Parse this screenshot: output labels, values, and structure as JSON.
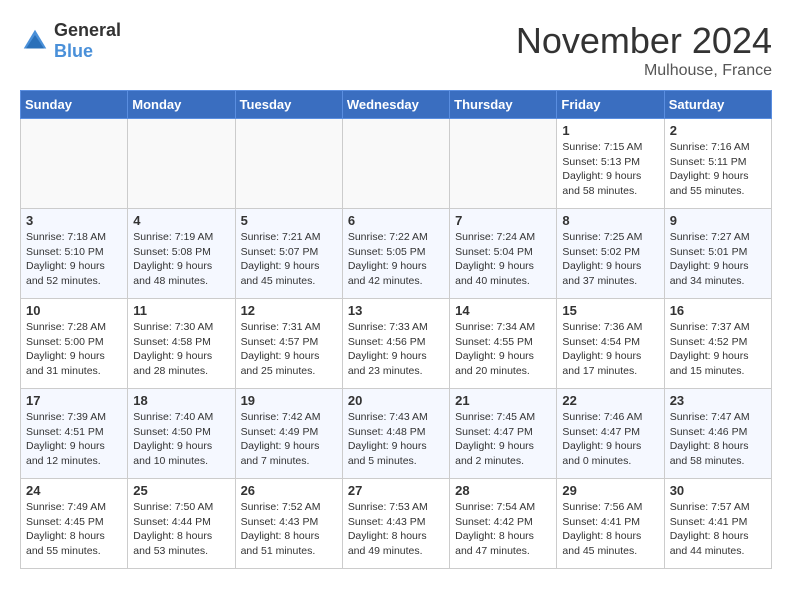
{
  "logo": {
    "text_general": "General",
    "text_blue": "Blue"
  },
  "title": "November 2024",
  "location": "Mulhouse, France",
  "headers": [
    "Sunday",
    "Monday",
    "Tuesday",
    "Wednesday",
    "Thursday",
    "Friday",
    "Saturday"
  ],
  "weeks": [
    [
      {
        "day": "",
        "info": ""
      },
      {
        "day": "",
        "info": ""
      },
      {
        "day": "",
        "info": ""
      },
      {
        "day": "",
        "info": ""
      },
      {
        "day": "",
        "info": ""
      },
      {
        "day": "1",
        "info": "Sunrise: 7:15 AM\nSunset: 5:13 PM\nDaylight: 9 hours\nand 58 minutes."
      },
      {
        "day": "2",
        "info": "Sunrise: 7:16 AM\nSunset: 5:11 PM\nDaylight: 9 hours\nand 55 minutes."
      }
    ],
    [
      {
        "day": "3",
        "info": "Sunrise: 7:18 AM\nSunset: 5:10 PM\nDaylight: 9 hours\nand 52 minutes."
      },
      {
        "day": "4",
        "info": "Sunrise: 7:19 AM\nSunset: 5:08 PM\nDaylight: 9 hours\nand 48 minutes."
      },
      {
        "day": "5",
        "info": "Sunrise: 7:21 AM\nSunset: 5:07 PM\nDaylight: 9 hours\nand 45 minutes."
      },
      {
        "day": "6",
        "info": "Sunrise: 7:22 AM\nSunset: 5:05 PM\nDaylight: 9 hours\nand 42 minutes."
      },
      {
        "day": "7",
        "info": "Sunrise: 7:24 AM\nSunset: 5:04 PM\nDaylight: 9 hours\nand 40 minutes."
      },
      {
        "day": "8",
        "info": "Sunrise: 7:25 AM\nSunset: 5:02 PM\nDaylight: 9 hours\nand 37 minutes."
      },
      {
        "day": "9",
        "info": "Sunrise: 7:27 AM\nSunset: 5:01 PM\nDaylight: 9 hours\nand 34 minutes."
      }
    ],
    [
      {
        "day": "10",
        "info": "Sunrise: 7:28 AM\nSunset: 5:00 PM\nDaylight: 9 hours\nand 31 minutes."
      },
      {
        "day": "11",
        "info": "Sunrise: 7:30 AM\nSunset: 4:58 PM\nDaylight: 9 hours\nand 28 minutes."
      },
      {
        "day": "12",
        "info": "Sunrise: 7:31 AM\nSunset: 4:57 PM\nDaylight: 9 hours\nand 25 minutes."
      },
      {
        "day": "13",
        "info": "Sunrise: 7:33 AM\nSunset: 4:56 PM\nDaylight: 9 hours\nand 23 minutes."
      },
      {
        "day": "14",
        "info": "Sunrise: 7:34 AM\nSunset: 4:55 PM\nDaylight: 9 hours\nand 20 minutes."
      },
      {
        "day": "15",
        "info": "Sunrise: 7:36 AM\nSunset: 4:54 PM\nDaylight: 9 hours\nand 17 minutes."
      },
      {
        "day": "16",
        "info": "Sunrise: 7:37 AM\nSunset: 4:52 PM\nDaylight: 9 hours\nand 15 minutes."
      }
    ],
    [
      {
        "day": "17",
        "info": "Sunrise: 7:39 AM\nSunset: 4:51 PM\nDaylight: 9 hours\nand 12 minutes."
      },
      {
        "day": "18",
        "info": "Sunrise: 7:40 AM\nSunset: 4:50 PM\nDaylight: 9 hours\nand 10 minutes."
      },
      {
        "day": "19",
        "info": "Sunrise: 7:42 AM\nSunset: 4:49 PM\nDaylight: 9 hours\nand 7 minutes."
      },
      {
        "day": "20",
        "info": "Sunrise: 7:43 AM\nSunset: 4:48 PM\nDaylight: 9 hours\nand 5 minutes."
      },
      {
        "day": "21",
        "info": "Sunrise: 7:45 AM\nSunset: 4:47 PM\nDaylight: 9 hours\nand 2 minutes."
      },
      {
        "day": "22",
        "info": "Sunrise: 7:46 AM\nSunset: 4:47 PM\nDaylight: 9 hours\nand 0 minutes."
      },
      {
        "day": "23",
        "info": "Sunrise: 7:47 AM\nSunset: 4:46 PM\nDaylight: 8 hours\nand 58 minutes."
      }
    ],
    [
      {
        "day": "24",
        "info": "Sunrise: 7:49 AM\nSunset: 4:45 PM\nDaylight: 8 hours\nand 55 minutes."
      },
      {
        "day": "25",
        "info": "Sunrise: 7:50 AM\nSunset: 4:44 PM\nDaylight: 8 hours\nand 53 minutes."
      },
      {
        "day": "26",
        "info": "Sunrise: 7:52 AM\nSunset: 4:43 PM\nDaylight: 8 hours\nand 51 minutes."
      },
      {
        "day": "27",
        "info": "Sunrise: 7:53 AM\nSunset: 4:43 PM\nDaylight: 8 hours\nand 49 minutes."
      },
      {
        "day": "28",
        "info": "Sunrise: 7:54 AM\nSunset: 4:42 PM\nDaylight: 8 hours\nand 47 minutes."
      },
      {
        "day": "29",
        "info": "Sunrise: 7:56 AM\nSunset: 4:41 PM\nDaylight: 8 hours\nand 45 minutes."
      },
      {
        "day": "30",
        "info": "Sunrise: 7:57 AM\nSunset: 4:41 PM\nDaylight: 8 hours\nand 44 minutes."
      }
    ]
  ]
}
